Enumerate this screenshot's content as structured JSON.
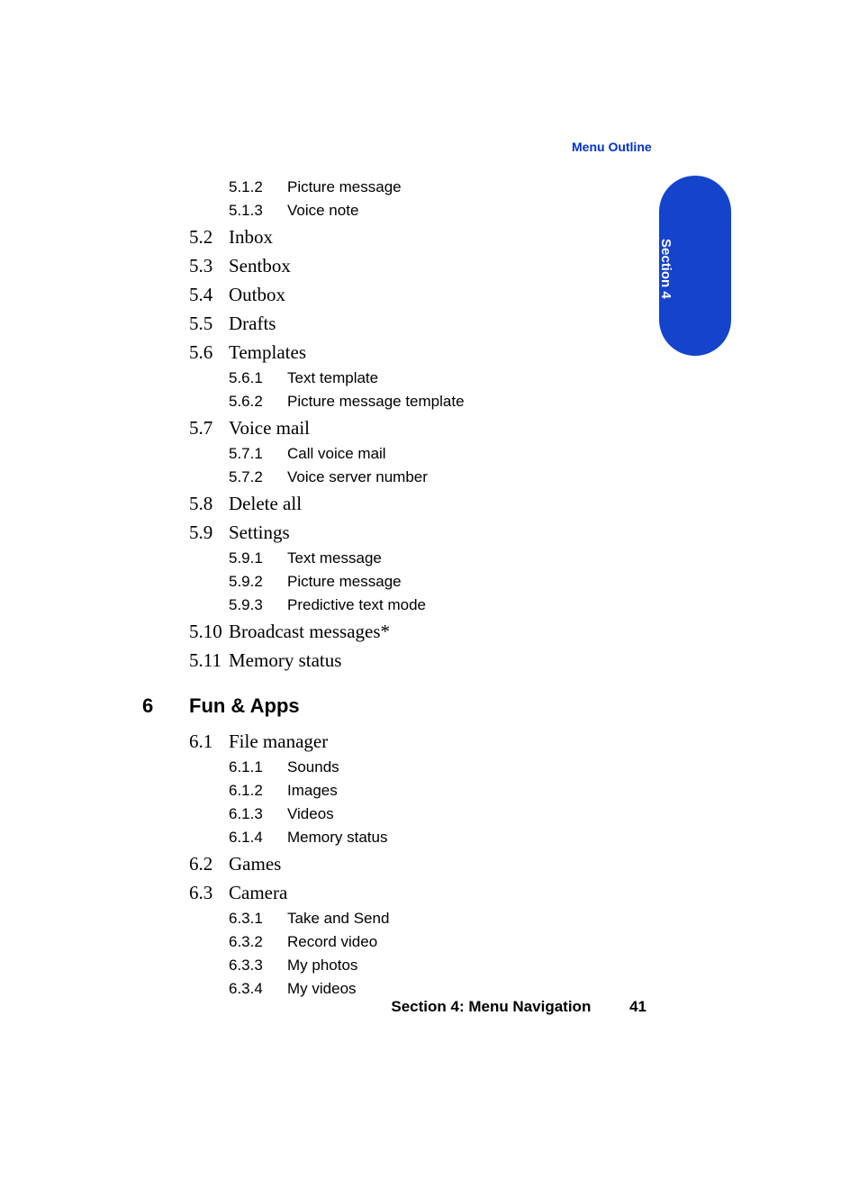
{
  "header": {
    "link": "Menu Outline"
  },
  "tab": {
    "label": "Section 4"
  },
  "outline": {
    "pre_subs": [
      {
        "num": "5.1.2",
        "label": "Picture message"
      },
      {
        "num": "5.1.3",
        "label": "Voice note"
      }
    ],
    "items": [
      {
        "num": "5.2",
        "label": "Inbox",
        "subs": []
      },
      {
        "num": "5.3",
        "label": "Sentbox",
        "subs": []
      },
      {
        "num": "5.4",
        "label": "Outbox",
        "subs": []
      },
      {
        "num": "5.5",
        "label": "Drafts",
        "subs": []
      },
      {
        "num": "5.6",
        "label": "Templates",
        "subs": [
          {
            "num": "5.6.1",
            "label": "Text template"
          },
          {
            "num": "5.6.2",
            "label": "Picture message template"
          }
        ]
      },
      {
        "num": "5.7",
        "label": "Voice mail",
        "subs": [
          {
            "num": "5.7.1",
            "label": "Call voice mail"
          },
          {
            "num": "5.7.2",
            "label": "Voice server number"
          }
        ]
      },
      {
        "num": "5.8",
        "label": "Delete all",
        "subs": []
      },
      {
        "num": "5.9",
        "label": "Settings",
        "subs": [
          {
            "num": "5.9.1",
            "label": "Text message"
          },
          {
            "num": "5.9.2",
            "label": "Picture message"
          },
          {
            "num": "5.9.3",
            "label": "Predictive text mode"
          }
        ]
      },
      {
        "num": "5.10",
        "label": "Broadcast messages*",
        "subs": []
      },
      {
        "num": "5.11",
        "label": "Memory status",
        "subs": []
      }
    ],
    "section6": {
      "num": "6",
      "label": "Fun & Apps",
      "items": [
        {
          "num": "6.1",
          "label": "File manager",
          "subs": [
            {
              "num": "6.1.1",
              "label": "Sounds"
            },
            {
              "num": "6.1.2",
              "label": "Images"
            },
            {
              "num": "6.1.3",
              "label": "Videos"
            },
            {
              "num": "6.1.4",
              "label": "Memory status"
            }
          ]
        },
        {
          "num": "6.2",
          "label": "Games",
          "subs": []
        },
        {
          "num": "6.3",
          "label": "Camera",
          "subs": [
            {
              "num": "6.3.1",
              "label": "Take and Send"
            },
            {
              "num": "6.3.2",
              "label": "Record video"
            },
            {
              "num": "6.3.3",
              "label": "My photos"
            },
            {
              "num": "6.3.4",
              "label": "My videos"
            }
          ]
        }
      ]
    }
  },
  "footer": {
    "section": "Section 4: Menu Navigation",
    "page": "41"
  }
}
